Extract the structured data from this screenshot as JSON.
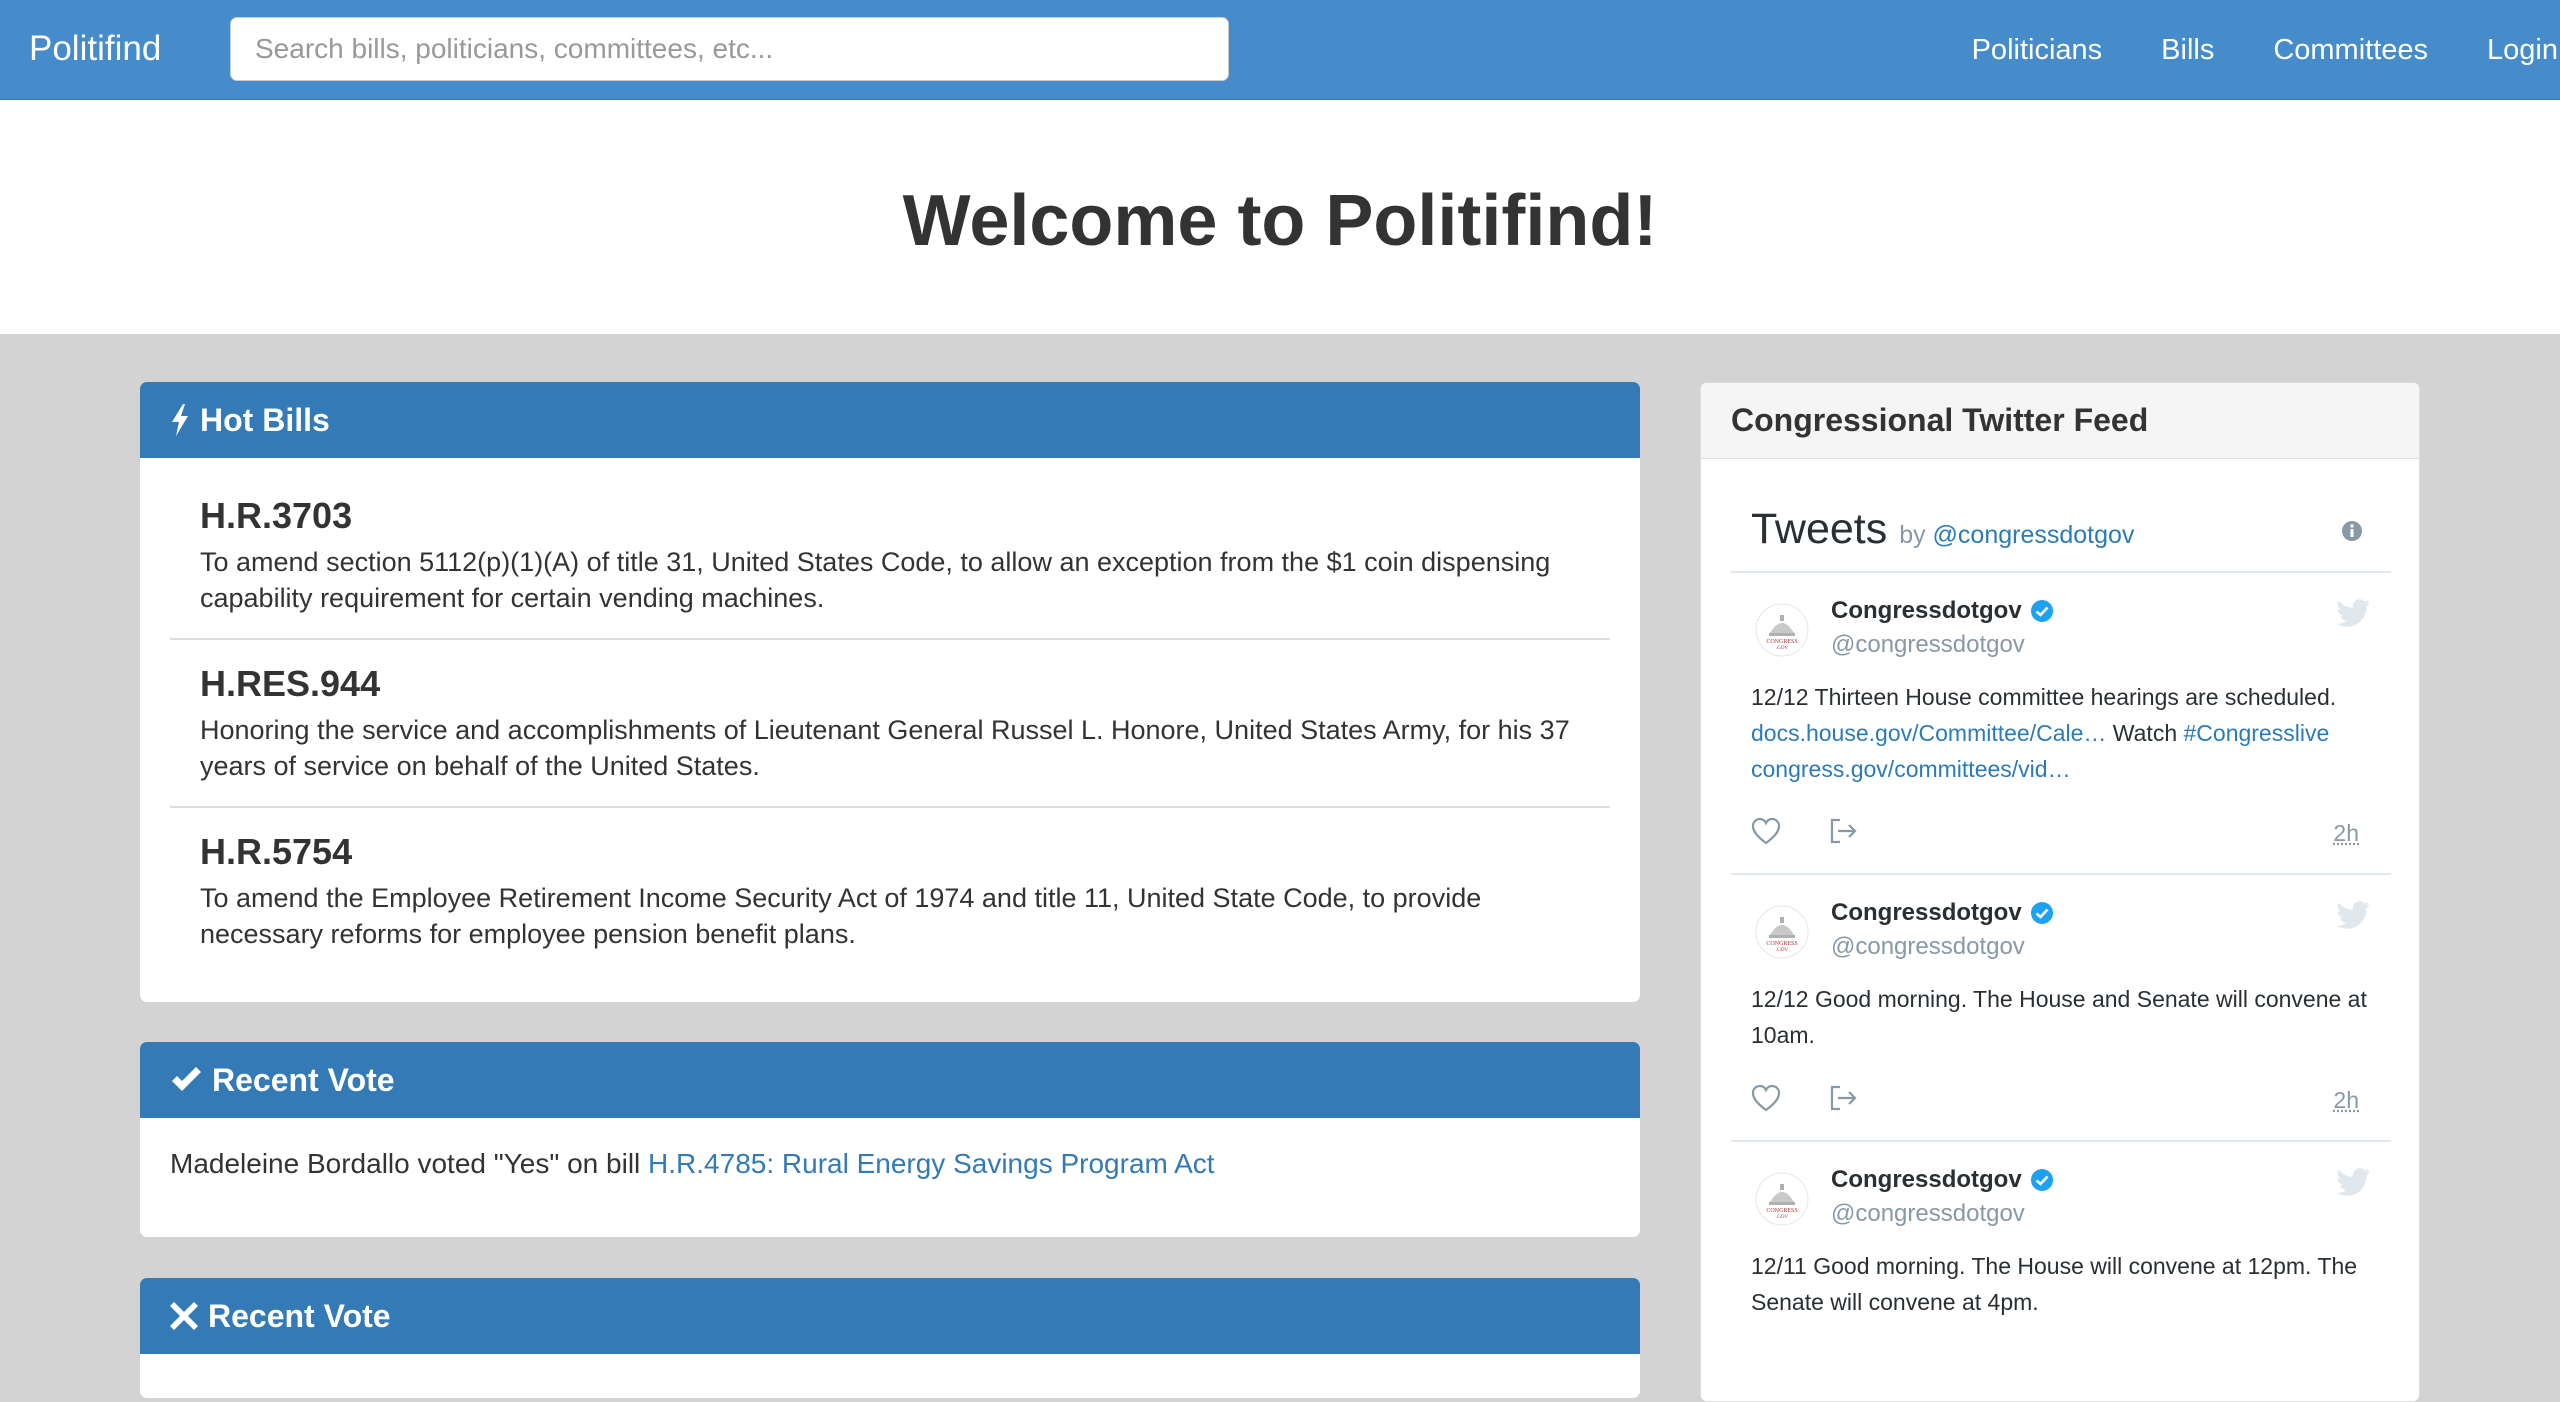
{
  "navbar": {
    "brand": "Politifind",
    "search_placeholder": "Search bills, politicians, committees, etc...",
    "links": [
      "Politicians",
      "Bills",
      "Committees",
      "Login"
    ]
  },
  "hero": {
    "title": "Welcome to Politifind!"
  },
  "hot_bills": {
    "title": "Hot Bills",
    "icon": "bolt-icon",
    "items": [
      {
        "number": "H.R.3703",
        "description": "To amend section 5112(p)(1)(A) of title 31, United States Code, to allow an exception from the $1 coin dispensing capability requirement for certain vending machines."
      },
      {
        "number": "H.RES.944",
        "description": "Honoring the service and accomplishments of Lieutenant General Russel L. Honore, United States Army, for his 37 years of service on behalf of the United States."
      },
      {
        "number": "H.R.5754",
        "description": "To amend the Employee Retirement Income Security Act of 1974 and title 11, United State Code, to provide necessary reforms for employee pension benefit plans."
      }
    ]
  },
  "recent_vote_1": {
    "title": "Recent Vote",
    "icon": "checkmark-icon",
    "text": "Madeleine Bordallo voted \"Yes\" on bill ",
    "link": "H.R.4785: Rural Energy Savings Program Act"
  },
  "recent_vote_2": {
    "title": "Recent Vote",
    "icon": "x-icon"
  },
  "twitter": {
    "heading": "Congressional Twitter Feed",
    "widget_title": "Tweets",
    "by": "by",
    "by_handle": "@congressdotgov",
    "tweets": [
      {
        "name": "Congressdotgov",
        "handle": "@congressdotgov",
        "text_1": "12/12 Thirteen House committee hearings are scheduled. ",
        "link_1": "docs.house.gov/Committee/Cale…",
        "text_2": " Watch ",
        "link_2": "#Congresslive",
        "link_3": "congress.gov/committees/vid…",
        "time": "2h"
      },
      {
        "name": "Congressdotgov",
        "handle": "@congressdotgov",
        "text": "12/12 Good morning. The House and Senate will convene at 10am.",
        "time": "2h"
      },
      {
        "name": "Congressdotgov",
        "handle": "@congressdotgov",
        "text": "12/11 Good morning. The House will convene at 12pm. The Senate will convene at 4pm."
      }
    ]
  },
  "colors": {
    "navbar": "#468ccb",
    "panel_heading": "#337ab7",
    "background": "#d3d3d3",
    "link": "#337ab7",
    "twitter_link": "#2b7bb9"
  }
}
